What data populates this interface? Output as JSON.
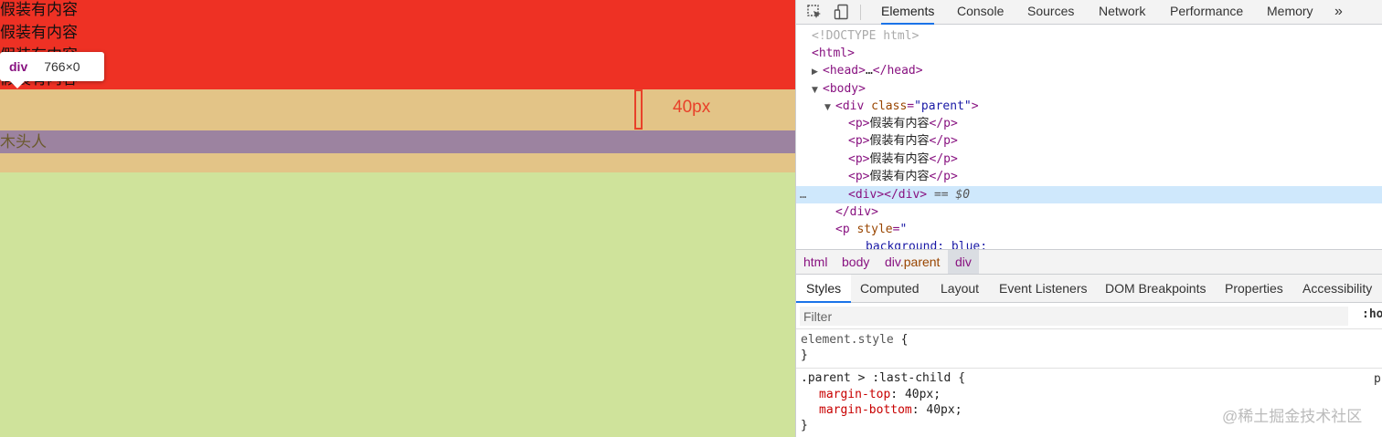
{
  "page": {
    "paragraphs": [
      "假装有内容",
      "假装有内容",
      "假装有内容",
      "假装有内容"
    ],
    "purple_text": "木头人",
    "annotation_label": "40px",
    "tooltip": {
      "tag": "div",
      "size": "766×0"
    },
    "colors": {
      "red": "#ee3124",
      "margin": "#e3c487",
      "purple": "#9c83a0",
      "green": "#cfe39b",
      "annotation": "#e8412a"
    }
  },
  "devtools": {
    "toolbar_icons": [
      "inspect-icon",
      "device-toggle-icon"
    ],
    "tabs": [
      {
        "label": "Elements",
        "active": true
      },
      {
        "label": "Console",
        "active": false
      },
      {
        "label": "Sources",
        "active": false
      },
      {
        "label": "Network",
        "active": false
      },
      {
        "label": "Performance",
        "active": false
      },
      {
        "label": "Memory",
        "active": false
      }
    ],
    "more_tabs": "»",
    "dom": {
      "doctype": "<!DOCTYPE html>",
      "html_open": "html",
      "head_open": "head",
      "head_ellipsis": "…",
      "head_close": "/head",
      "body_open": "body",
      "div_tag": "div",
      "div_attr": "class",
      "div_val": "\"parent\"",
      "p_tag": "p",
      "p_text": "假装有内容",
      "p_close": "/p",
      "inner_div_open": "div",
      "inner_div_close": "/div",
      "selected_marker": "== $0",
      "div_close": "/div",
      "p_style_attr": "style",
      "p_style_val": "\"",
      "partial_line": "background: blue;",
      "row_menu": "…"
    },
    "breadcrumb": [
      {
        "tag": "html",
        "cls": ""
      },
      {
        "tag": "body",
        "cls": ""
      },
      {
        "tag": "div",
        "cls": ".parent"
      },
      {
        "tag": "div",
        "cls": ""
      }
    ],
    "subtabs": [
      {
        "label": "Styles",
        "active": true
      },
      {
        "label": "Computed",
        "active": false
      },
      {
        "label": "Layout",
        "active": false
      },
      {
        "label": "Event Listeners",
        "active": false
      },
      {
        "label": "DOM Breakpoints",
        "active": false
      },
      {
        "label": "Properties",
        "active": false
      },
      {
        "label": "Accessibility",
        "active": false
      }
    ],
    "filter": {
      "placeholder": "Filter",
      "value": ""
    },
    "hov_toggle": ":ho",
    "styles": {
      "element_style_selector": "element.style",
      "open_brace": "{",
      "close_brace": "}",
      "rule_selector": ".parent > :last-child",
      "source_link": "p",
      "declarations": [
        {
          "prop": "margin-top",
          "value": "40px"
        },
        {
          "prop": "margin-bottom",
          "value": "40px"
        }
      ]
    },
    "watermark": "@稀土掘金技术社区"
  }
}
